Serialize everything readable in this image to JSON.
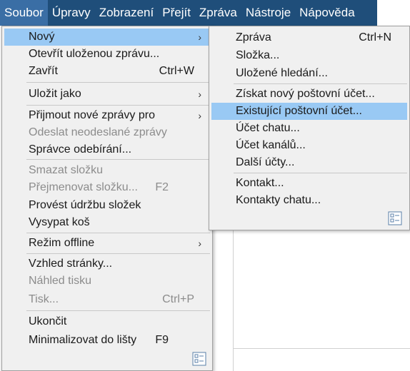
{
  "menubar": {
    "items": [
      {
        "label": "Soubor"
      },
      {
        "label": "Úpravy"
      },
      {
        "label": "Zobrazení"
      },
      {
        "label": "Přejít"
      },
      {
        "label": "Zpráva"
      },
      {
        "label": "Nástroje"
      },
      {
        "label": "Nápověda"
      }
    ]
  },
  "file_menu": {
    "items": [
      {
        "label": "Nový",
        "shortcut": "",
        "submenu": true,
        "disabled": false
      },
      {
        "label": "Otevřít uloženou zprávu...",
        "shortcut": "",
        "disabled": false
      },
      {
        "label": "Zavřít",
        "shortcut": "Ctrl+W",
        "disabled": false
      },
      {
        "label": "Uložit jako",
        "shortcut": "",
        "submenu": true,
        "disabled": false
      },
      {
        "label": "Přijmout nové zprávy pro",
        "shortcut": "",
        "submenu": true,
        "disabled": false
      },
      {
        "label": "Odeslat neodeslané zprávy",
        "shortcut": "",
        "disabled": true
      },
      {
        "label": "Správce odebírání...",
        "shortcut": "",
        "disabled": false
      },
      {
        "label": "Smazat složku",
        "shortcut": "",
        "disabled": true
      },
      {
        "label": "Přejmenovat složku...",
        "shortcut": "F2",
        "disabled": true
      },
      {
        "label": "Provést údržbu složek",
        "shortcut": "",
        "disabled": false
      },
      {
        "label": "Vysypat koš",
        "shortcut": "",
        "disabled": false
      },
      {
        "label": "Režim offline",
        "shortcut": "",
        "submenu": true,
        "disabled": false
      },
      {
        "label": "Vzhled stránky...",
        "shortcut": "",
        "disabled": false
      },
      {
        "label": "Náhled tisku",
        "shortcut": "",
        "disabled": true
      },
      {
        "label": "Tisk...",
        "shortcut": "Ctrl+P",
        "disabled": true
      },
      {
        "label": "Ukončit",
        "shortcut": "",
        "disabled": false
      },
      {
        "label": "Minimalizovat do lišty",
        "shortcut": "F9",
        "disabled": false
      }
    ]
  },
  "new_submenu": {
    "items": [
      {
        "label": "Zpráva",
        "shortcut": "Ctrl+N"
      },
      {
        "label": "Složka...",
        "shortcut": ""
      },
      {
        "label": "Uložené hledání...",
        "shortcut": ""
      },
      {
        "label": "Získat nový poštovní účet...",
        "shortcut": ""
      },
      {
        "label": "Existující poštovní účet...",
        "shortcut": ""
      },
      {
        "label": "Účet chatu...",
        "shortcut": ""
      },
      {
        "label": "Účet kanálů...",
        "shortcut": ""
      },
      {
        "label": "Další účty...",
        "shortcut": ""
      },
      {
        "label": "Kontakt...",
        "shortcut": ""
      },
      {
        "label": "Kontakty chatu...",
        "shortcut": ""
      }
    ]
  },
  "colors": {
    "menubar_bg": "#1f4e7a",
    "highlight": "#99c9f4",
    "menu_bg": "#f0f0f0",
    "disabled_text": "#8c8c8c"
  },
  "icons": {
    "submenu_arrow": "chevron-right-icon",
    "customize": "customize-menu-icon"
  }
}
